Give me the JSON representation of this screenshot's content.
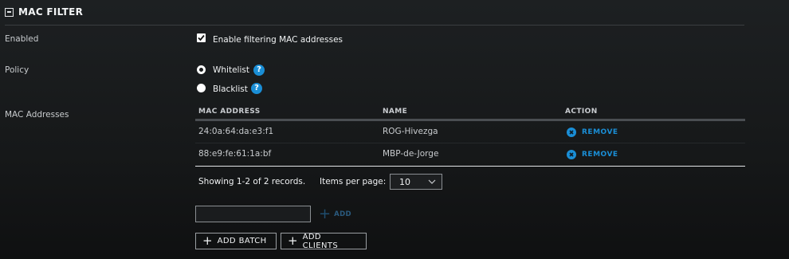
{
  "section": {
    "title": "MAC FILTER"
  },
  "enabled": {
    "label": "Enabled",
    "checkbox_label": "Enable filtering MAC addresses",
    "checked": true
  },
  "policy": {
    "label": "Policy",
    "options": [
      {
        "label": "Whitelist",
        "selected": true,
        "help": "?"
      },
      {
        "label": "Blacklist",
        "selected": false,
        "help": "?"
      }
    ]
  },
  "mac_addresses": {
    "label": "MAC Addresses",
    "columns": [
      "MAC ADDRESS",
      "NAME",
      "ACTION"
    ],
    "rows": [
      {
        "mac": "24:0a:64:da:e3:f1",
        "name": "ROG-Hivezga",
        "action": "REMOVE"
      },
      {
        "mac": "88:e9:fe:61:1a:bf",
        "name": "MBP-de-Jorge",
        "action": "REMOVE"
      }
    ],
    "showing": "Showing 1-2 of 2 records.",
    "items_per_page_label": "Items per page:",
    "items_per_page_value": "10",
    "input_value": "",
    "add_label": "ADD",
    "add_batch_label": "ADD BATCH",
    "add_clients_label": "ADD CLIENTS"
  },
  "colors": {
    "accent": "#1a8ed6",
    "background": "#161819"
  }
}
